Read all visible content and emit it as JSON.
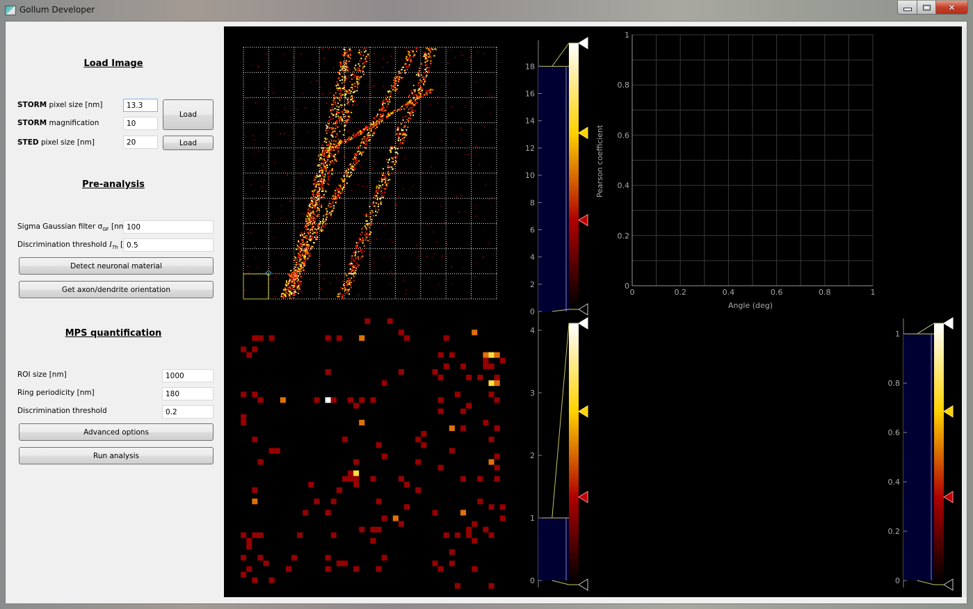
{
  "window": {
    "title": "Gollum Developer",
    "controls": {
      "minimize": "minimize-icon",
      "maximize": "maximize-icon",
      "close": "✕"
    }
  },
  "load_image": {
    "title": "Load Image",
    "storm_pixel_size": {
      "bold": "STORM",
      "label": " pixel size [nm]",
      "value": "13.3"
    },
    "storm_magnification": {
      "bold": "STORM",
      "label": " magnification",
      "value": "10"
    },
    "sted_pixel_size": {
      "bold": "STED",
      "label": " pixel size [nm]",
      "value": "20"
    },
    "load_storm_button": "Load",
    "load_sted_button": "Load"
  },
  "pre_analysis": {
    "title": "Pre-analysis",
    "sigma_label": "Sigma Gaussian filter σ",
    "sigma_sub": "GF",
    "sigma_unit": " [nm]",
    "sigma_value": "100",
    "threshold_label": "Discrimination threshold ",
    "threshold_symbol": "I",
    "threshold_sub": "Th",
    "threshold_unit": " [σ]",
    "threshold_value": "0.5",
    "detect_button": "Detect neuronal material",
    "orientation_button": "Get axon/dendrite orientation"
  },
  "mps": {
    "title": "MPS quantification",
    "roi_label": "ROI size [nm]",
    "roi_value": "1000",
    "ring_label": "Ring periodicity [nm]",
    "ring_value": "180",
    "disc_label": "Discrimination threshold",
    "disc_value": "0.2",
    "advanced_button": "Advanced options",
    "run_button": "Run analysis"
  },
  "histograms": {
    "top": {
      "ticks": [
        "0",
        "2",
        "4",
        "6",
        "8",
        "10",
        "12",
        "14",
        "16",
        "18"
      ],
      "hist_max": 18,
      "axis_max": 19.5
    },
    "middle": {
      "ticks": [
        "0",
        "1",
        "2",
        "3",
        "4"
      ],
      "hist_max": 1,
      "axis_max": 4.1
    },
    "right": {
      "ticks": [
        "0",
        "0.2",
        "0.4",
        "0.6",
        "0.8",
        "1"
      ],
      "hist_max": 1,
      "axis_max": 1.04
    },
    "colors": {
      "hist_fill": "#000033",
      "white_handle": "#ffffff",
      "yellow_handle": "#ffd200",
      "red_handle": "#c00000"
    }
  },
  "chart_data": {
    "type": "line",
    "title": "",
    "xlabel": "Angle (deg)",
    "ylabel": "Pearson coefficient",
    "xlim": [
      0,
      1
    ],
    "ylim": [
      0,
      1
    ],
    "x_ticks": [
      "0",
      "0.2",
      "0.4",
      "0.6",
      "0.8",
      "1"
    ],
    "y_ticks": [
      "0",
      "0.2",
      "0.4",
      "0.6",
      "0.8",
      "1"
    ],
    "grid": true,
    "series": []
  }
}
